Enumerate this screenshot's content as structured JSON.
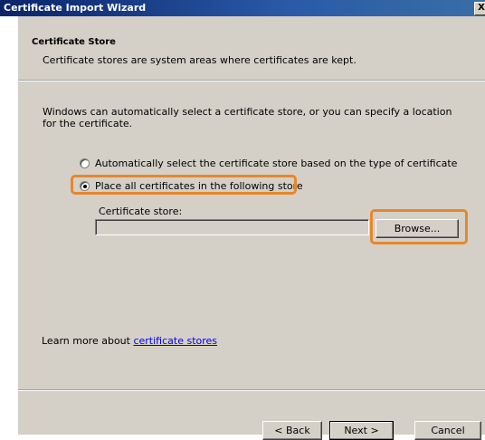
{
  "window": {
    "title": "Certificate Import Wizard",
    "close_label": "X"
  },
  "header": {
    "title": "Certificate Store",
    "subtitle": "Certificate stores are system areas where certificates are kept."
  },
  "main": {
    "intro": "Windows can automatically select a certificate store, or you can specify a location for the certificate.",
    "options": [
      {
        "label": "Automatically select the certificate store based on the type of certificate",
        "selected": false
      },
      {
        "label": "Place all certificates in the following store",
        "selected": true
      }
    ],
    "store_label": "Certificate store:",
    "store_value": "",
    "browse_label": "Browse...",
    "learn_prefix": "Learn more about ",
    "learn_link": "certificate stores"
  },
  "footer": {
    "back_label": "< Back",
    "next_label": "Next >",
    "cancel_label": "Cancel"
  },
  "colors": {
    "highlight": "#e8862a",
    "dialog_bg": "#d4d0c8",
    "titlebar": "#0a246a",
    "link": "#0000ee"
  }
}
